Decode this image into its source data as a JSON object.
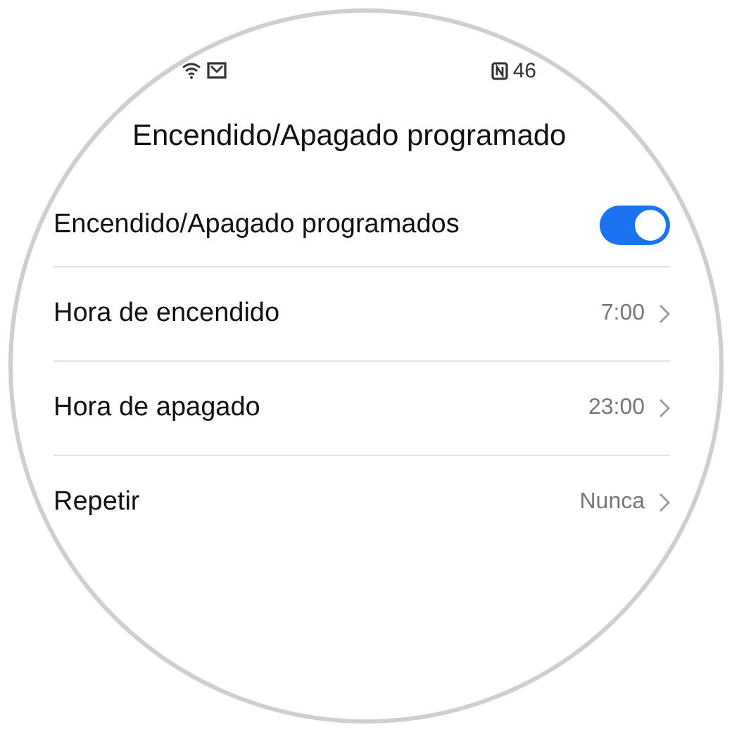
{
  "status_bar": {
    "battery": "46"
  },
  "title": "Encendido/Apagado programado",
  "rows": [
    {
      "kind": "toggle",
      "label": "Encendido/Apagado programados",
      "on": true
    },
    {
      "kind": "value",
      "label": "Hora de encendido",
      "value": "7:00"
    },
    {
      "kind": "value",
      "label": "Hora de apagado",
      "value": "23:00"
    },
    {
      "kind": "value",
      "label": "Repetir",
      "value": "Nunca"
    }
  ]
}
